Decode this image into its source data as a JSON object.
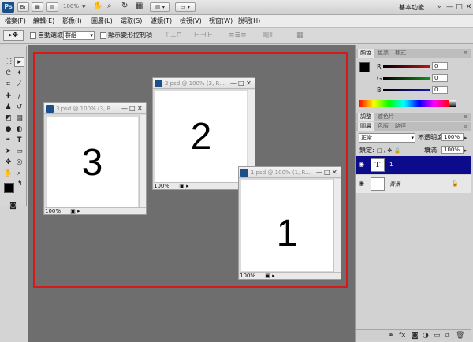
{
  "app": {
    "logo": "Ps",
    "zoom": "100%",
    "workspace_label": "基本功能",
    "win_controls": [
      "—",
      "□",
      "✕"
    ]
  },
  "menu": [
    "檔案(F)",
    "編輯(E)",
    "影像(I)",
    "圖層(L)",
    "選取(S)",
    "濾鏡(T)",
    "檢視(V)",
    "視窗(W)",
    "說明(H)"
  ],
  "options": {
    "auto_select_label": "自動選取:",
    "auto_select_value": "群組",
    "transform_label": "顯示變形控制項"
  },
  "documents": [
    {
      "title": "3.psd @ 100% (3, R...",
      "number": "3",
      "zoom": "100%"
    },
    {
      "title": "2.psd @ 100% (2, R...",
      "number": "2",
      "zoom": "100%"
    },
    {
      "title": "1.psd @ 100% (1, R...",
      "number": "1",
      "zoom": "100%"
    }
  ],
  "color_panel": {
    "tabs": [
      "顏色",
      "色票",
      "樣式"
    ],
    "channels": [
      {
        "label": "R",
        "value": "0",
        "color": "#c21414"
      },
      {
        "label": "G",
        "value": "0",
        "color": "#149414"
      },
      {
        "label": "B",
        "value": "0",
        "color": "#1414c2"
      }
    ]
  },
  "adjust_panel": {
    "tabs": [
      "調整",
      "遮色片"
    ]
  },
  "layers_panel": {
    "tabs": [
      "圖層",
      "色版",
      "路徑"
    ],
    "blend_mode": "正常",
    "opacity_label": "不透明度:",
    "opacity_value": "100%",
    "lock_label": "鎖定:",
    "fill_label": "填滿:",
    "fill_value": "100%",
    "layers": [
      {
        "thumb": "T",
        "name": "1"
      },
      {
        "thumb": "",
        "name": "背景"
      }
    ],
    "selected_color": "#0b0b8c"
  }
}
